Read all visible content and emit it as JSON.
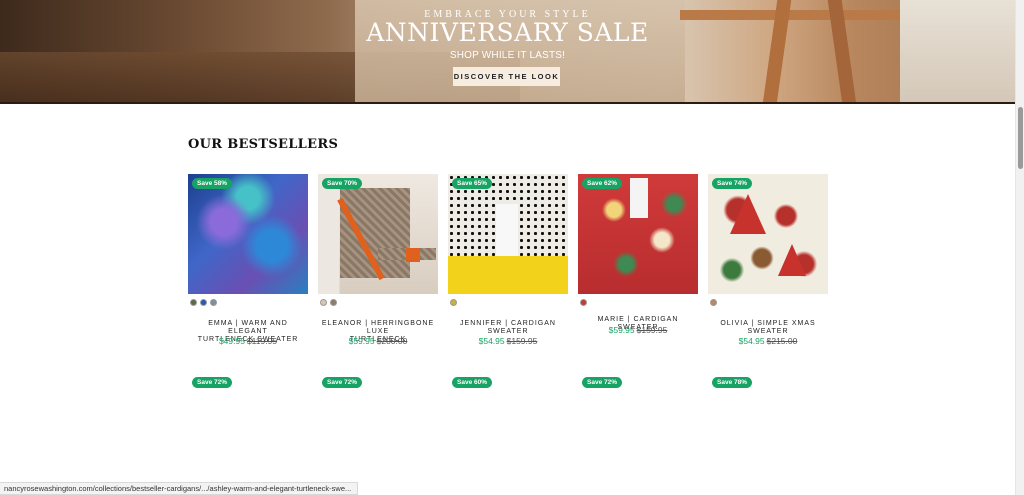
{
  "hero": {
    "kicker": "EMBRACE YOUR STYLE",
    "title": "ANNIVERSARY SALE",
    "subtitle": "SHOP WHILE IT LASTS!",
    "cta_label": "DISCOVER THE LOOK"
  },
  "section": {
    "title": "OUR BESTSELLERS"
  },
  "products": [
    {
      "badge": "Save 58%",
      "name_line1": "EMMA | WARM AND ELEGANT",
      "name_line2": "TURTLENECK SWEATER",
      "price": "$49.95",
      "compare_price": "$119.95",
      "swatches": [
        "#5a6b4a",
        "#2b57b5",
        "#7b8fa0"
      ]
    },
    {
      "badge": "Save 70%",
      "name_line1": "ELEANOR | HERRINGBONE LUXE",
      "name_line2": "TURTLENECK",
      "price": "$59.95",
      "compare_price": "$200.00",
      "swatches": [
        "#d8c6b0",
        "#8f7b66"
      ]
    },
    {
      "badge": "Save 65%",
      "name_line1": "JENNIFER | CARDIGAN",
      "name_line2": "SWEATER",
      "price": "$54.95",
      "compare_price": "$159.95",
      "swatches": [
        "#c9b23a"
      ]
    },
    {
      "badge": "Save 62%",
      "name_line1": "MARIE | CARDIGAN SWEATER",
      "name_line2": "",
      "price": "$59.95",
      "compare_price": "$159.95",
      "swatches": [
        "#c53a35"
      ]
    },
    {
      "badge": "Save 74%",
      "name_line1": "OLIVIA | SIMPLE XMAS",
      "name_line2": "SWEATER",
      "price": "$54.95",
      "compare_price": "$215.00",
      "swatches": [
        "#b98a5e"
      ]
    }
  ],
  "row2_badges": [
    "Save 72%",
    "Save 72%",
    "Save 60%",
    "Save 72%",
    "Save 78%"
  ],
  "status_url": "nancyrosewashington.com/collections/bestseller-cardigans/.../ashley-warm-and-elegant-turtleneck-swe...",
  "colors": {
    "accent_green": "#17a363",
    "hero_button_bg": "#f6ecdf"
  }
}
